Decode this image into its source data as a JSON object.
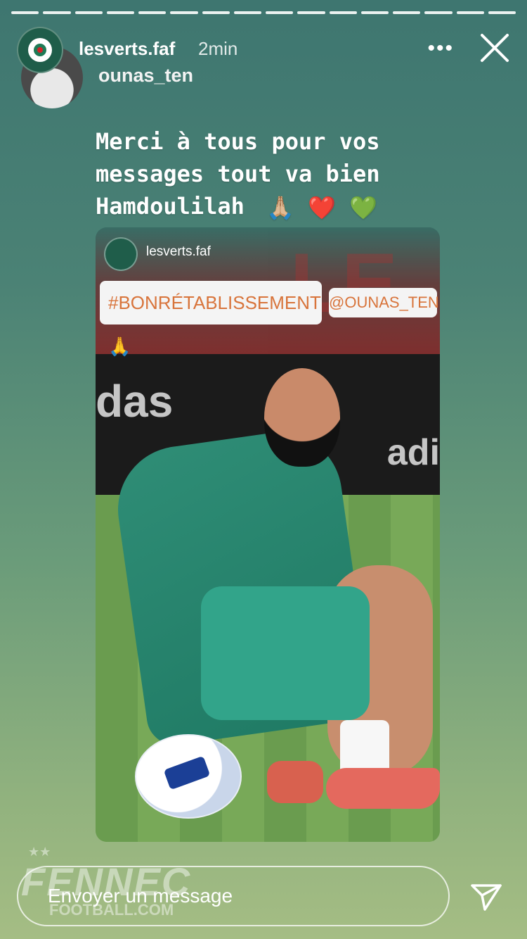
{
  "story": {
    "progress_segments": 16,
    "account": "lesverts.faf",
    "time": "2min",
    "reposted_account": "ounas_ten",
    "caption_lines": [
      "Merci à tous pour vos",
      "messages tout va bien",
      "Hamdoulilah"
    ],
    "caption_emojis": [
      "🙏🏼",
      "❤️",
      "💚"
    ]
  },
  "post": {
    "username": "lesverts.faf",
    "sticker_hashtag": "#BONRÉTABLISSEMENT🙏",
    "sticker_mention": "@OUNAS_TEN",
    "board_logo_left": "das",
    "board_logo_right": "adi"
  },
  "reply": {
    "placeholder": "Envoyer un message"
  },
  "watermark": {
    "title": "FENNEC",
    "subtitle": "FOOTBALL.COM",
    "stars": "★★"
  },
  "colors": {
    "sticker_text": "#d8743b",
    "background_top": "#3e7670",
    "background_bottom": "#a5bd84"
  },
  "icons": [
    "more-icon",
    "close-icon",
    "send-icon"
  ]
}
